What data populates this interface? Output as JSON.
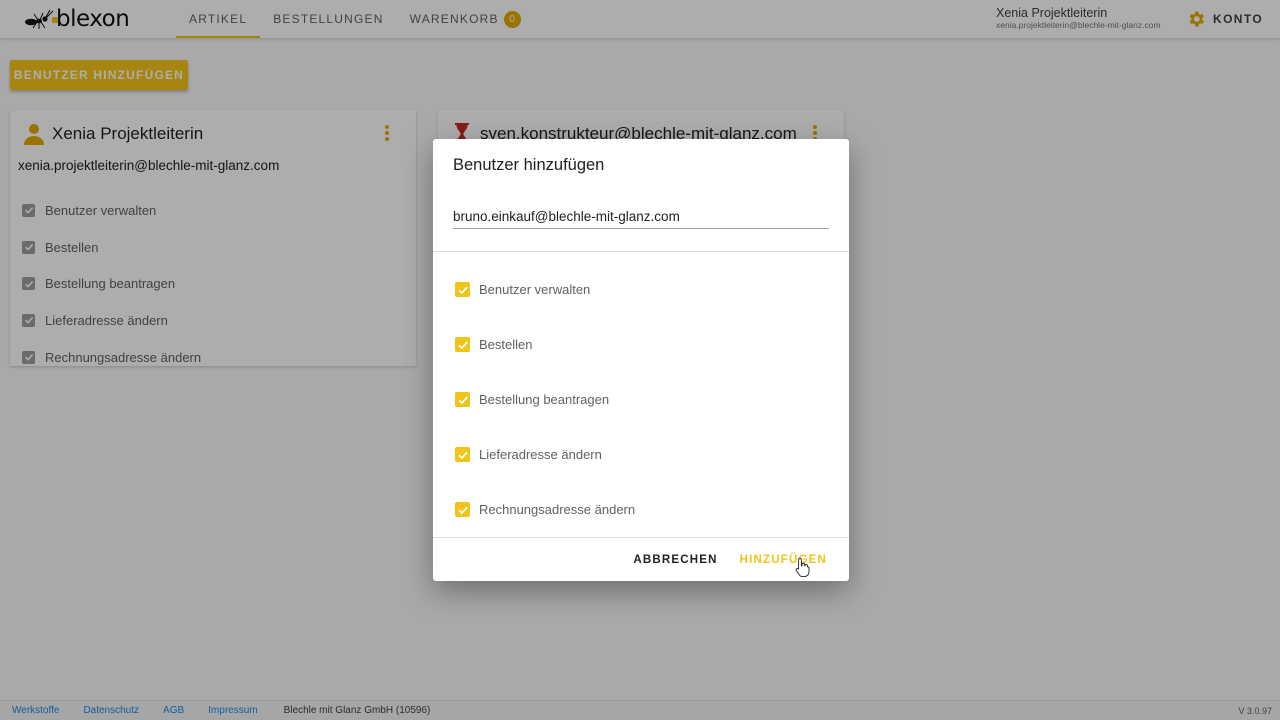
{
  "header": {
    "logo_text": "blexon",
    "nav": [
      {
        "label": "ARTIKEL",
        "active": true
      },
      {
        "label": "BESTELLUNGEN",
        "active": false
      },
      {
        "label": "WARENKORB",
        "active": false,
        "badge": "0"
      }
    ],
    "user_name": "Xenia Projektleiterin",
    "user_email": "xenia.projektleiterin@blechle-mit-glanz.com",
    "account_label": "KONTO"
  },
  "page": {
    "add_user_button": "BENUTZER HINZUFÜGEN",
    "cards": [
      {
        "title": "Xenia Projektleiterin",
        "email": "xenia.projektleiterin@blechle-mit-glanz.com",
        "permissions": [
          "Benutzer verwalten",
          "Bestellen",
          "Bestellung beantragen",
          "Lieferadresse ändern",
          "Rechnungsadresse ändern"
        ]
      },
      {
        "title": "sven.konstrukteur@blechle-mit-glanz.com"
      }
    ]
  },
  "dialog": {
    "title": "Benutzer hinzufügen",
    "email_value": "bruno.einkauf@blechle-mit-glanz.com",
    "permissions": [
      {
        "label": "Benutzer verwalten",
        "checked": true
      },
      {
        "label": "Bestellen",
        "checked": true
      },
      {
        "label": "Bestellung beantragen",
        "checked": true
      },
      {
        "label": "Lieferadresse ändern",
        "checked": true
      },
      {
        "label": "Rechnungsadresse ändern",
        "checked": true
      }
    ],
    "cancel_label": "ABBRECHEN",
    "confirm_label": "HINZUFÜGEN"
  },
  "footer": {
    "links": [
      "Werkstoffe",
      "Datenschutz",
      "AGB",
      "Impressum"
    ],
    "company": "Blechle mit Glanz GmbH (10596)",
    "version": "V 3.0.97"
  },
  "colors": {
    "accent": "#f0c419",
    "badge": "#e2ac00",
    "link": "#1e88e5"
  },
  "icons": {
    "person": "person-icon",
    "hourglass": "hourglass-icon",
    "gear": "gear-icon",
    "kebab": "more-vert-icon",
    "check": "check-icon"
  }
}
